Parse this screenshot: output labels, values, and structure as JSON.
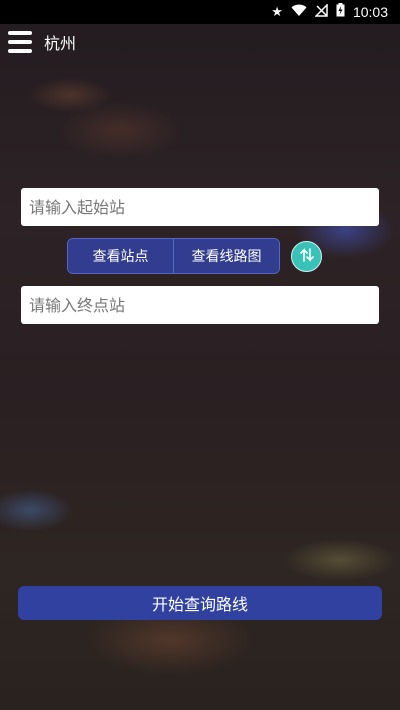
{
  "status_bar": {
    "time": "10:03",
    "icons": [
      "star-icon",
      "wifi-icon",
      "no-signal-icon",
      "battery-charging-icon"
    ]
  },
  "app_bar": {
    "menu_icon": "hamburger-menu-icon",
    "city": "杭州"
  },
  "form": {
    "start_placeholder": "请输入起始站",
    "end_placeholder": "请输入终点站",
    "view_stations_label": "查看站点",
    "view_map_label": "查看线路图",
    "swap_icon": "swap-arrows-icon",
    "search_label": "开始查询路线"
  },
  "colors": {
    "button_blue": "#323d8f",
    "swap_teal": "#38c2b8",
    "start_button": "#3141a0"
  }
}
